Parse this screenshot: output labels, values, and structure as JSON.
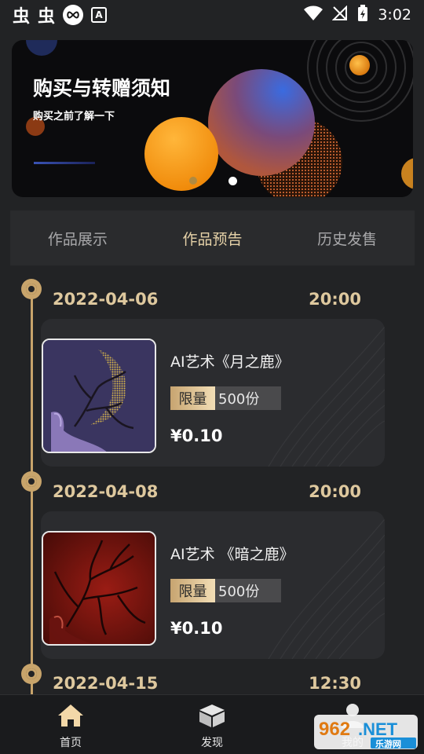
{
  "status_bar": {
    "left_glyphs": [
      "虫",
      "虫"
    ],
    "time": "3:02"
  },
  "banner": {
    "title": "购买与转赠须知",
    "subtitle": "购买之前了解一下"
  },
  "tabs": [
    {
      "label": "作品展示",
      "active": false
    },
    {
      "label": "作品预告",
      "active": true
    },
    {
      "label": "历史发售",
      "active": false
    }
  ],
  "schedule": [
    {
      "date": "2022-04-06",
      "time": "20:00",
      "title": "AI艺术《月之鹿》",
      "limit_label": "限量",
      "limit_count": "500份",
      "price": "¥0.10"
    },
    {
      "date": "2022-04-08",
      "time": "20:00",
      "title": "AI艺术 《暗之鹿》",
      "limit_label": "限量",
      "limit_count": "500份",
      "price": "¥0.10"
    },
    {
      "date": "2022-04-15",
      "time": "12:30"
    }
  ],
  "bottom_nav": [
    {
      "label": "首页",
      "icon": "home-icon"
    },
    {
      "label": "发现",
      "icon": "box-icon"
    },
    {
      "label": "我的",
      "icon": "person-icon"
    }
  ],
  "watermark": {
    "brand": "962.NET",
    "sub": "乐游网"
  },
  "colors": {
    "accent_gold": "#c8a46b",
    "text_gold": "#dec89e",
    "background": "#222325"
  }
}
